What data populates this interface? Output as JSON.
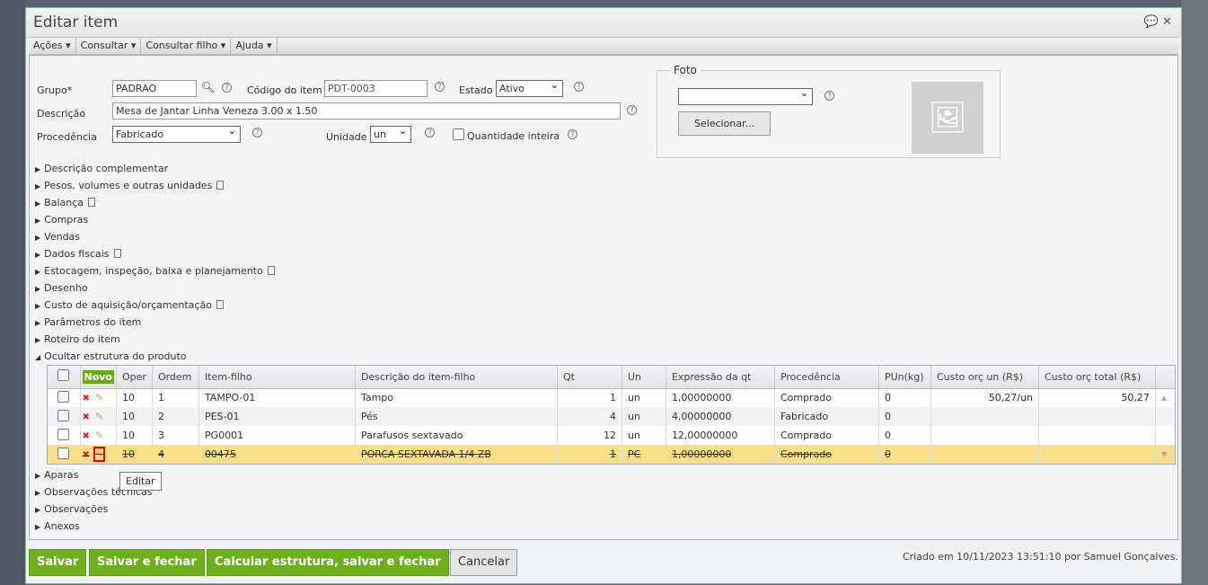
{
  "window": {
    "title": "Editar item"
  },
  "menu": [
    "Ações",
    "Consultar",
    "Consultar filho",
    "Ajuda"
  ],
  "form": {
    "grupo_label": "Grupo*",
    "grupo_value": "PADRAO",
    "codigo_label": "Código do item",
    "codigo_value": "PDT-0003",
    "estado_label": "Estado",
    "estado_value": "Ativo",
    "descricao_label": "Descrição",
    "descricao_value": "Mesa de Jantar Linha Veneza 3.00 x 1.50",
    "procedencia_label": "Procedência",
    "procedencia_value": "Fabricado",
    "unidade_label": "Unidade",
    "unidade_value": "un",
    "qtd_inteira_label": "Quantidade inteira"
  },
  "foto": {
    "label": "Foto",
    "select_value": "",
    "button": "Selecionar..."
  },
  "sections": [
    "Descrição complementar",
    "Pesos, volumes e outras unidades",
    "Balança",
    "Compras",
    "Vendas",
    "Dados fiscais",
    "Estocagem, inspeção, baixa e planejamento",
    "Desenho",
    "Custo de aquisição/orçamentação",
    "Parâmetros do item",
    "Roteiro do item",
    "Ocultar estrutura do produto"
  ],
  "sections_after": [
    "Aparas",
    "Observações técnicas",
    "Observações",
    "Anexos"
  ],
  "grid": {
    "novo": "Novo",
    "headers": [
      "Oper",
      "Ordem",
      "Item-filho",
      "Descrição do item-filho",
      "Qt",
      "Un",
      "Expressão da qt",
      "Procedência",
      "PUn(kg)",
      "Custo orç un (R$)",
      "Custo orç total (R$)"
    ],
    "rows": [
      [
        "10",
        "1",
        "TAMPO-01",
        "Tampo",
        "1",
        "un",
        "1,00000000",
        "Comprado",
        "0",
        "50,27/un",
        "50,27"
      ],
      [
        "10",
        "2",
        "PES-01",
        "Pés",
        "4",
        "un",
        "4,00000000",
        "Fabricado",
        "0",
        "",
        ""
      ],
      [
        "10",
        "3",
        "PG0001",
        "Parafusos sextavado",
        "12",
        "un",
        "12,00000000",
        "Comprado",
        "0",
        "",
        ""
      ],
      [
        "10",
        "4",
        "00475",
        "PORCA SEXTAVADA 1/4 ZB",
        "1",
        "PC",
        "1,00000000",
        "Comprado",
        "0",
        "",
        ""
      ]
    ]
  },
  "tooltip": "Editar",
  "buttons": {
    "salvar": "Salvar",
    "salvar_fechar": "Salvar e fechar",
    "calcular": "Calcular estrutura, salvar e fechar",
    "cancelar": "Cancelar"
  },
  "footer": "Criado em 10/11/2023 13:51:10 por Samuel Gonçalves."
}
